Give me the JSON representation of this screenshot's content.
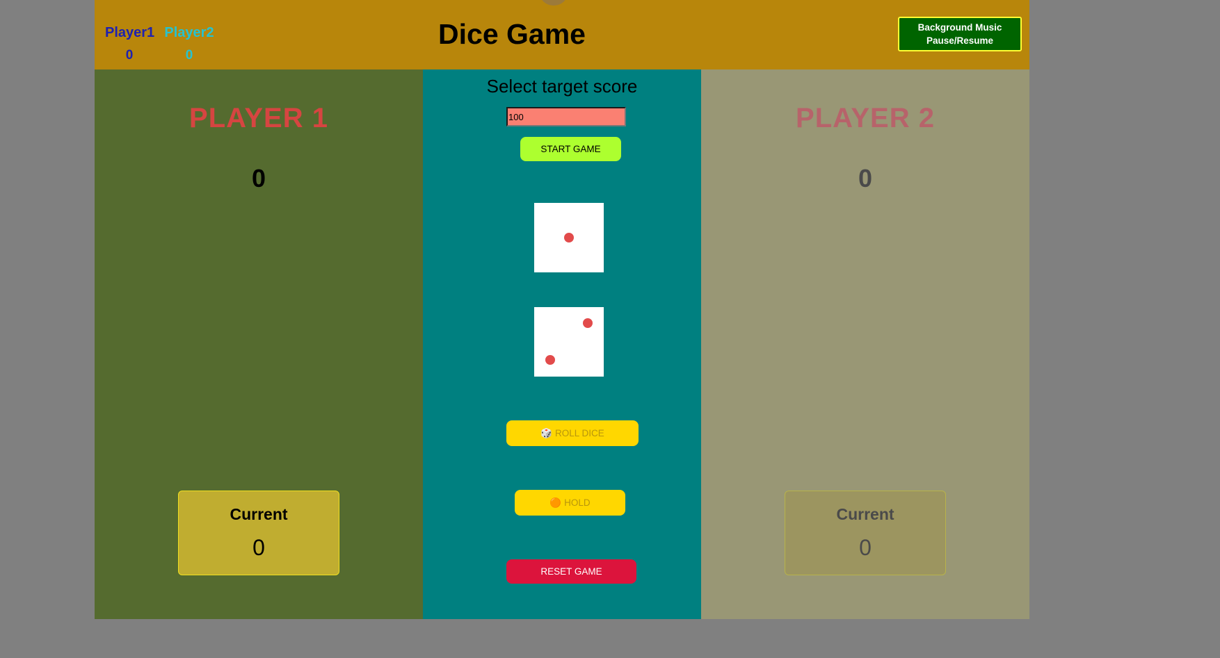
{
  "header": {
    "title": "Dice Game",
    "music_button": "Background Music\nPause/Resume",
    "scoreboard": [
      {
        "name": "Player1",
        "wins": "0",
        "color": "#1e22b0"
      },
      {
        "name": "Player2",
        "wins": "0",
        "color": "#27c2cf"
      }
    ]
  },
  "players": [
    {
      "name": "PLAYER 1",
      "score": "0",
      "current_label": "Current",
      "current_value": "0",
      "active": true
    },
    {
      "name": "PLAYER 2",
      "score": "0",
      "current_label": "Current",
      "current_value": "0",
      "active": false
    }
  ],
  "controls": {
    "target_label": "Select target score",
    "target_value": "100",
    "start_label": "START GAME",
    "roll_label": "ROLL DICE",
    "roll_icon": "🎲",
    "hold_label": "HOLD",
    "hold_icon": "🟠",
    "reset_label": "RESET GAME"
  },
  "dice": [
    {
      "value": 1,
      "icon": "die-face-1"
    },
    {
      "value": 2,
      "icon": "die-face-2"
    }
  ],
  "colors": {
    "header": "#b8860b",
    "player1_panel": "#556b2f",
    "center_panel": "#008080",
    "player2_panel": "#999775",
    "pip": "#e24b4b"
  }
}
